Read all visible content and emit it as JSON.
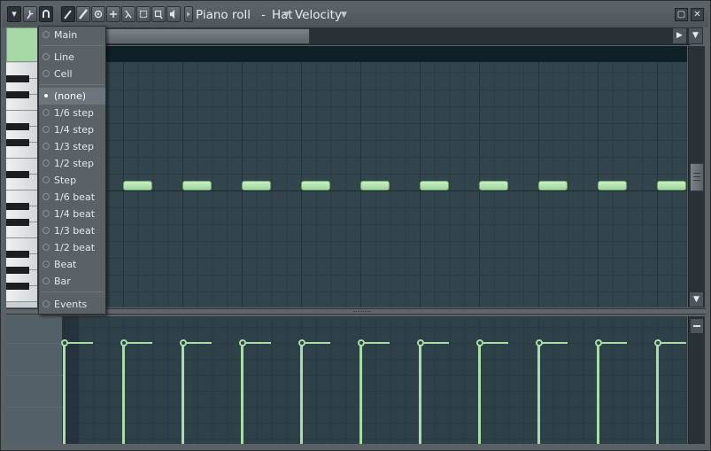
{
  "window": {
    "title_parts": [
      "Piano roll",
      "Hat",
      "Velocity"
    ],
    "ctrl_restore": "▢",
    "ctrl_close": "✕"
  },
  "toolbar": {
    "icons": [
      "dropdown-arrow-icon",
      "wrench-icon",
      "magnet-icon",
      "pencil-icon",
      "paint-brush-icon",
      "delete-icon",
      "mute-icon",
      "slice-icon",
      "select-icon",
      "zoom-icon",
      "playback-icon",
      "speaker-icon"
    ]
  },
  "snap_menu": {
    "items": [
      {
        "label": "Main",
        "selected": false
      },
      {
        "label": "Line",
        "selected": false
      },
      {
        "label": "Cell",
        "selected": false
      },
      {
        "label": "(none)",
        "selected": true
      },
      {
        "label": "1/6 step",
        "selected": false
      },
      {
        "label": "1/4 step",
        "selected": false
      },
      {
        "label": "1/3 step",
        "selected": false
      },
      {
        "label": "1/2 step",
        "selected": false
      },
      {
        "label": "Step",
        "selected": false
      },
      {
        "label": "1/6 beat",
        "selected": false
      },
      {
        "label": "1/4 beat",
        "selected": false
      },
      {
        "label": "1/3 beat",
        "selected": false
      },
      {
        "label": "1/2 beat",
        "selected": false
      },
      {
        "label": "Beat",
        "selected": false
      },
      {
        "label": "Bar",
        "selected": false
      },
      {
        "label": "Events",
        "selected": false
      }
    ]
  },
  "notes": {
    "count": 10,
    "color": "#b7e6b4"
  },
  "velocity_events": {
    "count": 11,
    "level": 0.18,
    "color": "#a9dca6"
  },
  "colors": {
    "grid_bg": "#33454c",
    "event_bg": "#2f4148",
    "menu_selected": "#6c757b"
  }
}
